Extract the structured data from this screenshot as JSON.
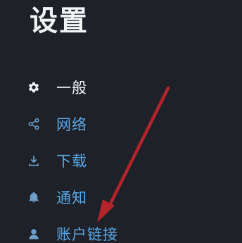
{
  "title": "设置",
  "menu": {
    "items": [
      {
        "label": "一般",
        "icon": "gear-icon",
        "active": true
      },
      {
        "label": "网络",
        "icon": "share-nodes-icon",
        "active": false
      },
      {
        "label": "下载",
        "icon": "download-icon",
        "active": false
      },
      {
        "label": "通知",
        "icon": "bell-icon",
        "active": false
      },
      {
        "label": "账户链接",
        "icon": "user-icon",
        "active": false
      }
    ]
  },
  "colors": {
    "background": "#1e2128",
    "title": "#f2f3f5",
    "active_text": "#f3f4f6",
    "link_text": "#5aa8e6",
    "icon_muted": "#6f9fc8",
    "annotation_arrow": "#b3242b"
  }
}
